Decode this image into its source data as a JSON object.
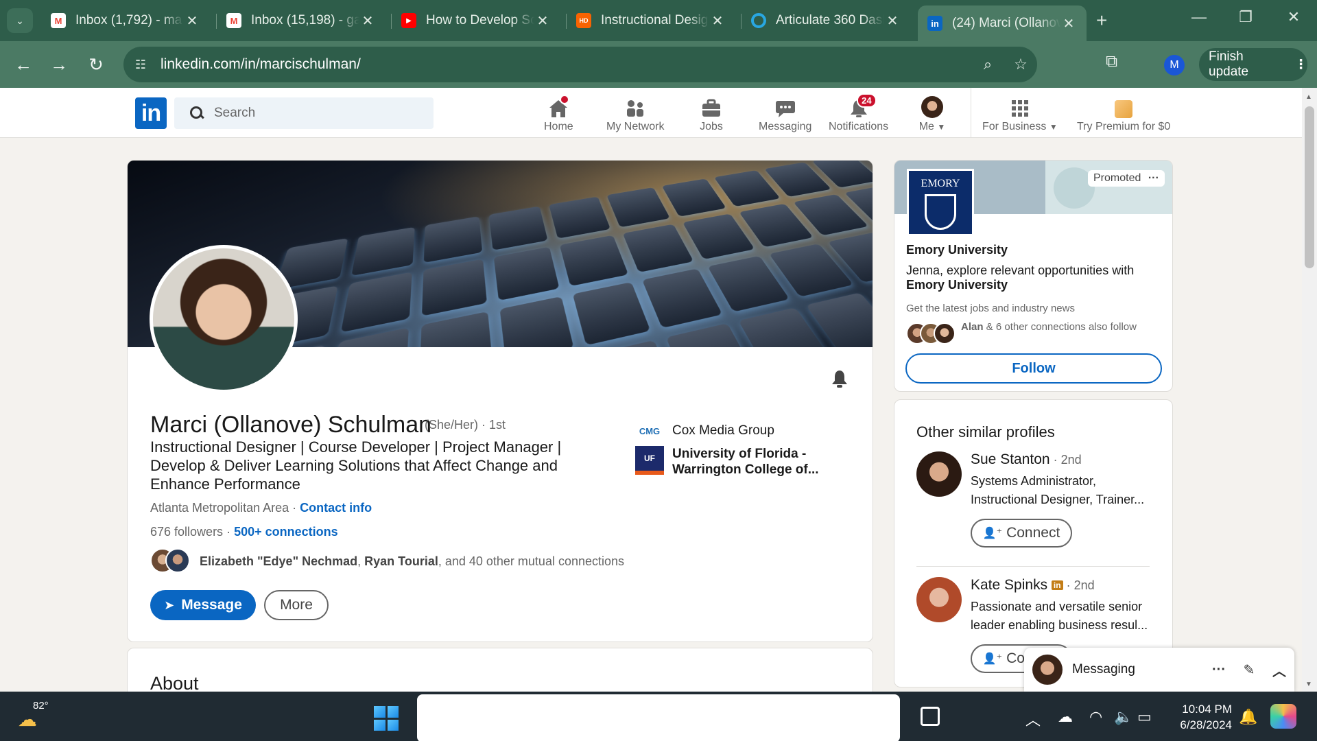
{
  "browser": {
    "tabs": [
      {
        "title": "Inbox (1,792) - ma",
        "favicon": "gmail-icon",
        "active": false
      },
      {
        "title": "Inbox (15,198) - ga",
        "favicon": "gmail-icon",
        "active": false
      },
      {
        "title": "How to Develop Sc",
        "favicon": "youtube-icon",
        "active": false
      },
      {
        "title": "Instructional Desig",
        "favicon": "home-depot-icon",
        "active": false
      },
      {
        "title": "Articulate 360 Dash",
        "favicon": "articulate-icon",
        "active": false
      },
      {
        "title": "(24) Marci (Ollanov",
        "favicon": "linkedin-icon",
        "active": true
      }
    ],
    "url": "linkedin.com/in/marcischulman/",
    "profile_initial": "M",
    "finish_update_label": "Finish update"
  },
  "linkedin": {
    "logo": "in",
    "search_placeholder": "Search",
    "nav": [
      {
        "label": "Home",
        "icon": "home-icon",
        "badge": ""
      },
      {
        "label": "My Network",
        "icon": "network-icon",
        "badge": ""
      },
      {
        "label": "Jobs",
        "icon": "briefcase-icon",
        "badge": ""
      },
      {
        "label": "Messaging",
        "icon": "messaging-icon",
        "badge": ""
      },
      {
        "label": "Notifications",
        "icon": "bell-icon",
        "badge": "24"
      },
      {
        "label": "Me",
        "icon": "avatar",
        "badge": ""
      },
      {
        "label": "For Business",
        "icon": "grid-icon",
        "badge": ""
      },
      {
        "label": "Try Premium for $0",
        "icon": "premium-icon",
        "badge": ""
      }
    ]
  },
  "profile": {
    "name": "Marci (Ollanove) Schulman",
    "pronouns_degree": "(She/Her) · 1st",
    "headline": "Instructional Designer | Course Developer | Project Manager | Develop & Deliver Learning Solutions that Affect Change and Enhance Performance",
    "location": "Atlanta Metropolitan Area",
    "location_sep": " · ",
    "contact_info": "Contact info",
    "followers": "676 followers",
    "followers_sep": " · ",
    "connections": "500+ connections",
    "mutual_name1": "Elizabeth \"Edye\" Nechmad",
    "mutual_sep": ", ",
    "mutual_name2": "Ryan Tourial",
    "mutual_rest": ", and 40 other mutual connections",
    "message_label": "Message",
    "more_label": "More",
    "experience": [
      {
        "name": "Cox Media Group",
        "logo_text": "CMG"
      },
      {
        "name": "University of Florida - Warrington College of...",
        "logo_text": "UF"
      }
    ],
    "about_heading": "About"
  },
  "ad": {
    "promoted_label": "Promoted",
    "logo_text": "EMORY",
    "org_name": "Emory University",
    "body_prefix": "Jenna, explore relevant opportunities with ",
    "body_org": "Emory University",
    "sub": "Get the latest jobs and industry news",
    "follow_name": "Alan",
    "follow_rest": " & 6 other connections also follow",
    "follow_label": "Follow"
  },
  "similar": {
    "heading": "Other similar profiles",
    "profiles": [
      {
        "name": "Sue Stanton",
        "degree": " · 2nd",
        "desc": "Systems Administrator, Instructional Designer, Trainer...",
        "action": "Connect",
        "badge": ""
      },
      {
        "name": "Kate Spinks",
        "degree": " · 2nd",
        "desc": "Passionate and versatile senior leader enabling business resul...",
        "action": "Connect",
        "badge": "in"
      }
    ]
  },
  "messaging_bar": {
    "label": "Messaging"
  },
  "taskbar": {
    "temperature": "82°",
    "time": "10:04 PM",
    "date": "6/28/2024"
  },
  "colors": {
    "linkedin_blue": "#0a66c2",
    "browser_frame": "#2e5d4a",
    "notification_red": "#cb112d"
  }
}
